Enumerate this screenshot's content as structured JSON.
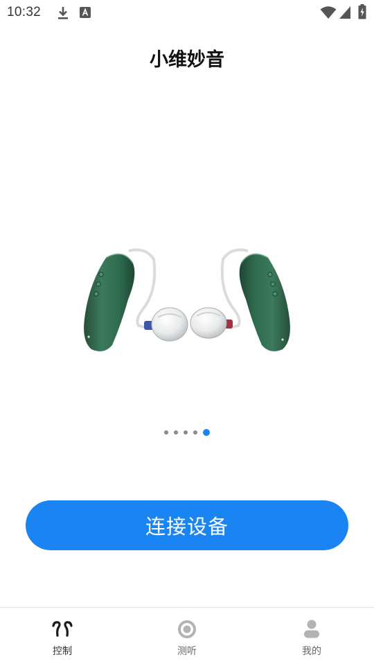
{
  "status_bar": {
    "time": "10:32"
  },
  "app": {
    "title": "小维妙音"
  },
  "carousel": {
    "page_count": 5,
    "active_index": 4
  },
  "main": {
    "connect_label": "连接设备"
  },
  "tabbar": {
    "tabs": [
      {
        "label": "控制",
        "icon": "hearing-aids-icon",
        "active": true
      },
      {
        "label": "测听",
        "icon": "target-icon",
        "active": false
      },
      {
        "label": "我的",
        "icon": "person-icon",
        "active": false
      }
    ]
  },
  "colors": {
    "accent": "#1a84f2",
    "device_green": "#2f6b4f"
  }
}
